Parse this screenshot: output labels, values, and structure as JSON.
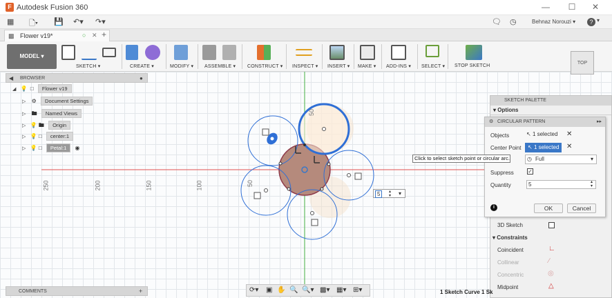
{
  "app": {
    "title": "Autodesk Fusion 360",
    "user": "Behnaz Norouzi ▾",
    "help": "?"
  },
  "document": {
    "tab_title": "Flower v19*"
  },
  "toolbar": {
    "model": "MODEL ▾",
    "groups": [
      {
        "label": "SKETCH ▾"
      },
      {
        "label": "CREATE ▾"
      },
      {
        "label": "MODIFY ▾"
      },
      {
        "label": "ASSEMBLE ▾"
      },
      {
        "label": "CONSTRUCT ▾"
      },
      {
        "label": "INSPECT ▾"
      },
      {
        "label": "INSERT ▾"
      },
      {
        "label": "MAKE ▾"
      },
      {
        "label": "ADD-INS ▾"
      },
      {
        "label": "SELECT ▾"
      },
      {
        "label": "STOP SKETCH"
      }
    ]
  },
  "viewcube": {
    "label": "TOP"
  },
  "browser": {
    "title": "BROWSER",
    "items": [
      {
        "label": "Flower v19"
      },
      {
        "label": "Document Settings"
      },
      {
        "label": "Named Views"
      },
      {
        "label": "Origin"
      },
      {
        "label": "center:1"
      },
      {
        "label": "Petal:1"
      }
    ]
  },
  "comments": {
    "title": "COMMENTS"
  },
  "ruler": {
    "labels": [
      "250",
      "200",
      "150",
      "100",
      "50"
    ],
    "vertical_label": "50"
  },
  "sketch_palette": {
    "title": "SKETCH PALETTE",
    "options_header": "▾ Options",
    "sketch3d_label": "3D Sketch",
    "constraints_header": "▾ Constraints",
    "constraints": [
      "Coincident",
      "Collinear",
      "Concentric",
      "Midpoint"
    ]
  },
  "circular_pattern": {
    "title": "CIRCULAR PATTERN",
    "objects_label": "Objects",
    "objects_value": "1 selected",
    "center_label": "Center Point",
    "center_value": "1 selected",
    "type_value": "Full",
    "suppress_label": "Suppress",
    "quantity_label": "Quantity",
    "quantity_value": "5",
    "ok": "OK",
    "cancel": "Cancel"
  },
  "tooltip": "Click to select sketch point or circular arc.",
  "inline_quantity": "5",
  "status": {
    "right_text": "1 Sketch Curve 1 Sk"
  },
  "colors": {
    "accent": "#3a77c7",
    "sketch_blue": "#2f6fd6",
    "axis_red": "#e05050",
    "axis_green": "#44b044",
    "fill_brown": "#b58a7c"
  }
}
